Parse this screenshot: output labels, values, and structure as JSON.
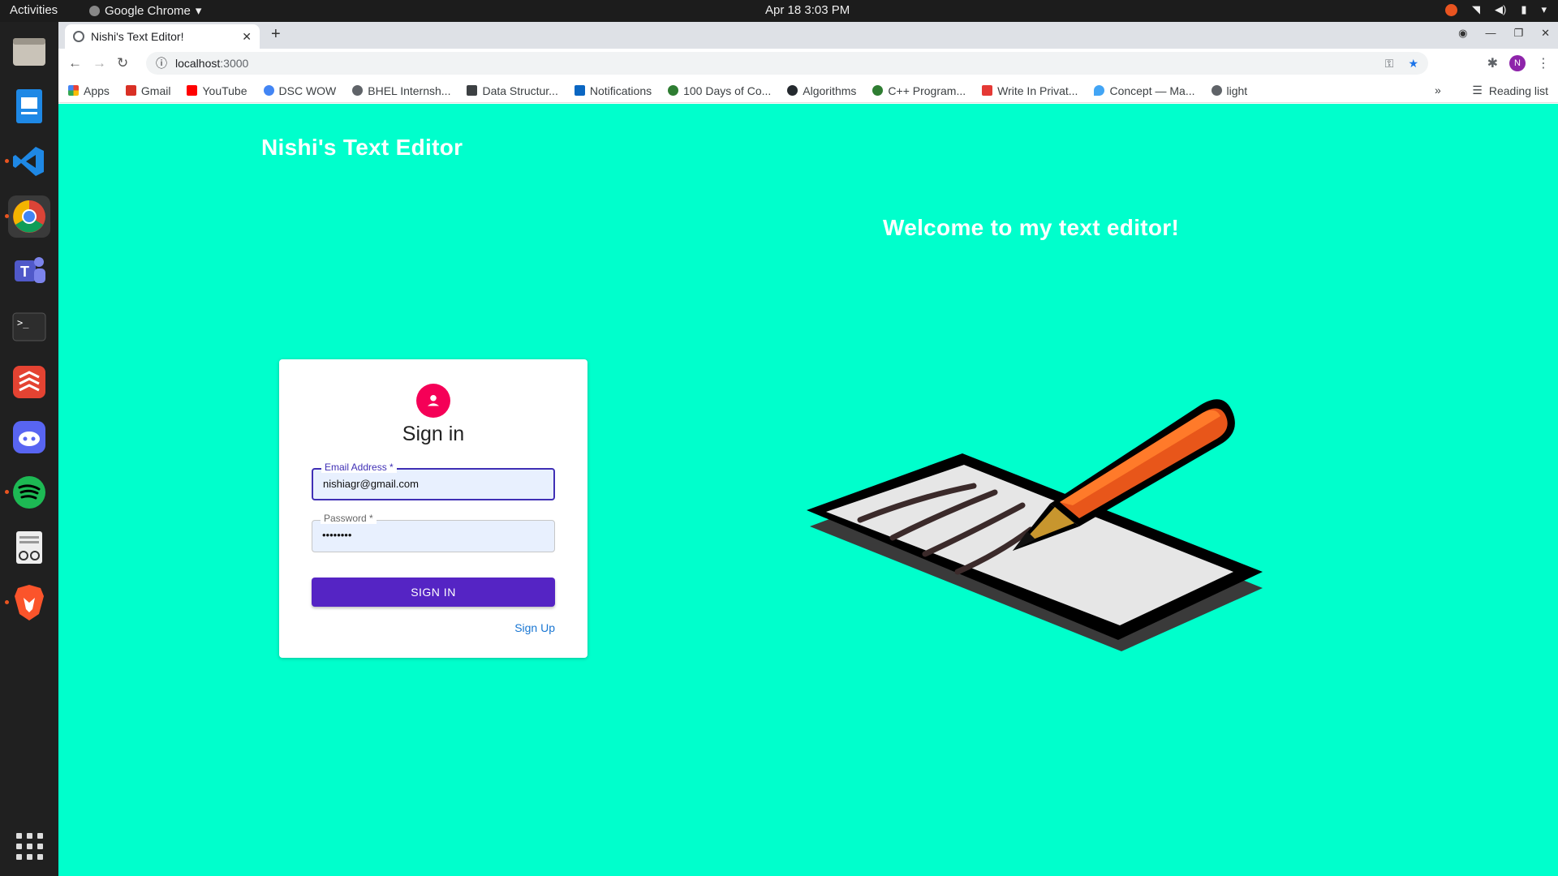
{
  "os": {
    "activities": "Activities",
    "app_name": "Google Chrome",
    "clock": "Apr 18  3:03 PM"
  },
  "browser": {
    "tab_title": "Nishi's Text Editor!",
    "url_host": "localhost",
    "url_port": ":3000",
    "profile_initial": "N",
    "bookmarks": [
      {
        "label": "Apps",
        "color": "#ea4335"
      },
      {
        "label": "Gmail",
        "color": "#d93025"
      },
      {
        "label": "YouTube",
        "color": "#ff0000"
      },
      {
        "label": "DSC WOW",
        "color": "#4285f4"
      },
      {
        "label": "BHEL Internsh...",
        "color": "#5f6368"
      },
      {
        "label": "Data Structur...",
        "color": "#3c4043"
      },
      {
        "label": "Notifications",
        "color": "#0a66c2"
      },
      {
        "label": "100 Days of Co...",
        "color": "#2e7d32"
      },
      {
        "label": "Algorithms",
        "color": "#24292e"
      },
      {
        "label": "C++ Program...",
        "color": "#2e7d32"
      },
      {
        "label": "Write In Privat...",
        "color": "#e53935"
      },
      {
        "label": "Concept — Ma...",
        "color": "#42a5f5"
      },
      {
        "label": "light",
        "color": "#5f6368"
      }
    ],
    "more_bookmarks": "»",
    "reading_list": "Reading list"
  },
  "page": {
    "brand": "Nishi's Text Editor",
    "welcome": "Welcome to my text editor!",
    "background": "#00ffcc",
    "signin": {
      "title": "Sign in",
      "email_label": "Email Address *",
      "email_value": "nishiagr@gmail.com",
      "password_label": "Password *",
      "password_value": "••••••••",
      "button_label": "SIGN IN",
      "signup_link": "Sign Up",
      "accent": "#5524c4",
      "avatar_color": "#f50057"
    }
  }
}
